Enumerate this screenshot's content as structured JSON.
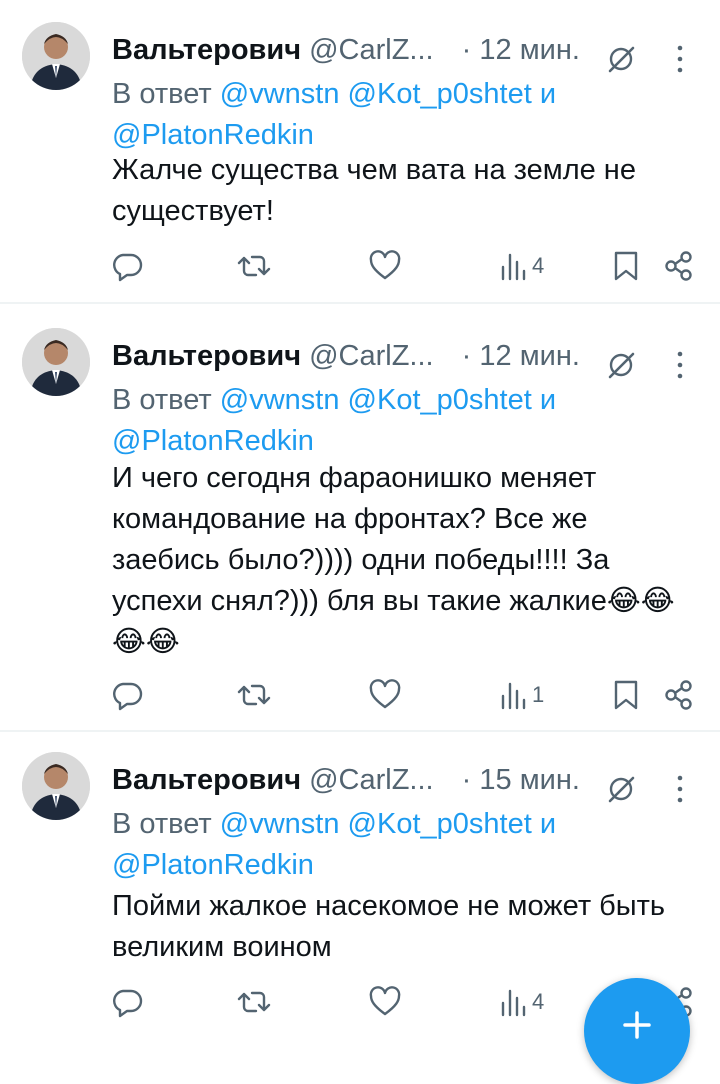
{
  "tweets": [
    {
      "author_name": "Вальтерович",
      "author_handle": "@CarlZ...",
      "dot": "·",
      "time": "12 мин.",
      "reply_prefix": "В ответ",
      "mentions": [
        "@vwnstn",
        "@Kot_p0shtet"
      ],
      "and_word": "и",
      "last_mention": "@PlatonRedkin",
      "text": "Жалче существа чем вата на земле не существует!",
      "views": "4",
      "icons": {
        "grok": "grok-icon",
        "more": "more-icon",
        "reply": "reply-icon",
        "retweet": "retweet-icon",
        "like": "heart-icon",
        "views": "views-icon",
        "bookmark": "bookmark-icon",
        "share": "share-icon"
      }
    },
    {
      "author_name": "Вальтерович",
      "author_handle": "@CarlZ...",
      "dot": "·",
      "time": "12 мин.",
      "reply_prefix": "В ответ",
      "mentions": [
        "@vwnstn",
        "@Kot_p0shtet"
      ],
      "and_word": "и",
      "last_mention": "@PlatonRedkin",
      "text": "И чего сегодня фараонишко меняет командование на фронтах? Все же заебись было?)))) одни победы!!!! За успехи снял?))) бля вы такие жалкие😂😂😂😂",
      "views": "1"
    },
    {
      "author_name": "Вальтерович",
      "author_handle": "@CarlZ...",
      "dot": "·",
      "time": "15 мин.",
      "reply_prefix": "В ответ",
      "mentions": [
        "@vwnstn",
        "@Kot_p0shtet"
      ],
      "and_word": "и",
      "last_mention": "@PlatonRedkin",
      "text": "Пойми жалкое насекомое не может быть великим воином",
      "views": "4"
    }
  ],
  "fab": {
    "icon": "plus-icon"
  },
  "colors": {
    "accent": "#1d9bf0",
    "secondary_text": "#536471",
    "divider": "#eff3f4"
  }
}
